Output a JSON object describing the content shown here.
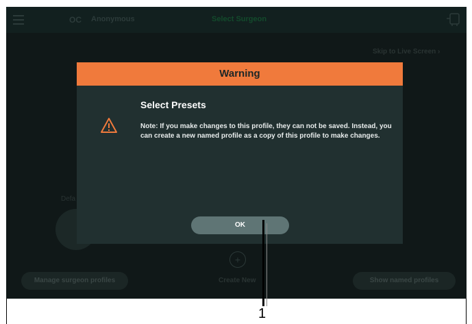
{
  "topbar": {
    "logo": "OC",
    "profile_name": "Anonymous",
    "title": "Select Surgeon"
  },
  "background": {
    "skip_link": "Skip to Live Screen  ›",
    "default_label": "Defa",
    "create_new_label": "Create New",
    "manage_button": "Manage surgeon profiles",
    "named_button": "Show named profiles",
    "plus": "+"
  },
  "dialog": {
    "header": "Warning",
    "title": "Select Presets",
    "text": "Note: If you make changes to this profile, they can not be saved. Instead, you can create a new named profile as a copy of this profile to make changes.",
    "ok_label": "OK",
    "icon": "warning-triangle-icon",
    "header_color": "#f07a3c"
  },
  "callout": {
    "number": "1"
  }
}
